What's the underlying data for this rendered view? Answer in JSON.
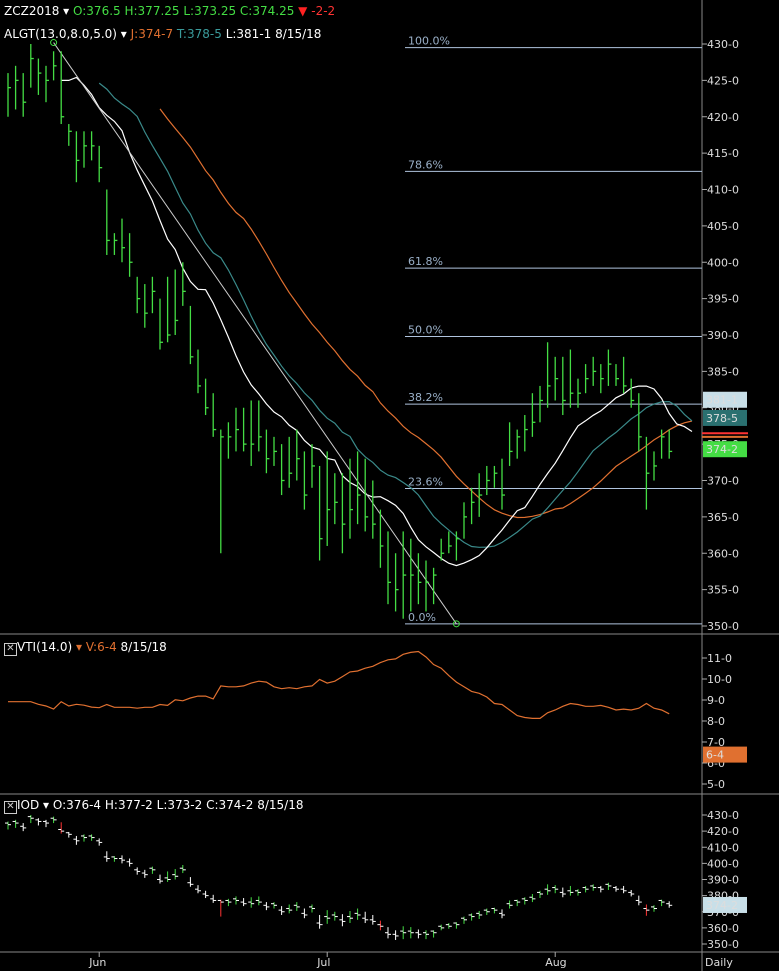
{
  "price_header": {
    "symbol": "ZCZ2018",
    "ohlc_open": "O:376.5",
    "ohlc_high": "H:377.25",
    "ohlc_low": "L:373.25",
    "ohlc_close": "C:374.25",
    "change": "-2-2"
  },
  "alligator_header": {
    "study": "ALGT(13.0,8.0,5.0)",
    "jaw": "J:374-7",
    "teeth": "T:378-5",
    "lips": "L:381-1",
    "date": "8/15/18"
  },
  "vti_header": {
    "study": "VTI(14.0)",
    "value": "V:6-4",
    "date": "8/15/18"
  },
  "iod_header": {
    "study": "IOD",
    "open": "O:376-4",
    "high": "H:377-2",
    "low": "L:373-2",
    "close": "C:374-2",
    "date": "8/15/18"
  },
  "badges": {
    "lips_badge": "381-1",
    "teeth_badge": "378-5",
    "price_badge": "374-2",
    "vti_badge": "6-4",
    "iod_badge": "374-2"
  },
  "colors": {
    "bar_green": "#44dd44",
    "bar_red": "#ff3333",
    "jaw": "#e07030",
    "teeth": "#3a8a8a",
    "lips": "#ffffff",
    "fib": "#b0c4de"
  },
  "x_axis": {
    "labels": [
      "Jun",
      "Jul",
      "Aug"
    ],
    "period": "Daily"
  },
  "chart_data": [
    {
      "type": "ohlc",
      "panel": "price",
      "ylim": [
        350,
        432
      ],
      "y_ticks": [
        "430-0",
        "425-0",
        "420-0",
        "415-0",
        "410-0",
        "405-0",
        "400-0",
        "395-0",
        "390-0",
        "385-0",
        "380-0",
        "375-0",
        "370-0",
        "365-0",
        "360-0",
        "355-0",
        "350-0"
      ],
      "fibonacci": [
        {
          "label": "100.0%",
          "value": 429.5
        },
        {
          "label": "78.6%",
          "value": 412.5
        },
        {
          "label": "61.8%",
          "value": 399.2
        },
        {
          "label": "50.0%",
          "value": 389.8
        },
        {
          "label": "38.2%",
          "value": 380.5
        },
        {
          "label": "23.6%",
          "value": 368.9
        },
        {
          "label": "0.0%",
          "value": 350.3
        }
      ],
      "bars": [
        {
          "h": 426,
          "l": 420,
          "c": 424
        },
        {
          "h": 427,
          "l": 421,
          "c": 425
        },
        {
          "h": 426,
          "l": 420,
          "c": 422
        },
        {
          "h": 430,
          "l": 424,
          "c": 428
        },
        {
          "h": 428,
          "l": 423,
          "c": 426
        },
        {
          "h": 427,
          "l": 422,
          "c": 425
        },
        {
          "h": 429,
          "l": 425,
          "c": 427
        },
        {
          "h": 429,
          "l": 419,
          "c": 420
        },
        {
          "h": 419,
          "l": 416,
          "c": 418
        },
        {
          "h": 418,
          "l": 411,
          "c": 414
        },
        {
          "h": 418,
          "l": 413,
          "c": 416
        },
        {
          "h": 418,
          "l": 414,
          "c": 416
        },
        {
          "h": 416,
          "l": 411,
          "c": 413
        },
        {
          "h": 410,
          "l": 401,
          "c": 403
        },
        {
          "h": 404,
          "l": 401,
          "c": 403
        },
        {
          "h": 406,
          "l": 400,
          "c": 402
        },
        {
          "h": 404,
          "l": 398,
          "c": 400
        },
        {
          "h": 398,
          "l": 393,
          "c": 395
        },
        {
          "h": 397,
          "l": 391,
          "c": 393
        },
        {
          "h": 398,
          "l": 393,
          "c": 396
        },
        {
          "h": 395,
          "l": 388,
          "c": 389
        },
        {
          "h": 398,
          "l": 389,
          "c": 390
        },
        {
          "h": 399,
          "l": 390,
          "c": 392
        },
        {
          "h": 400,
          "l": 394,
          "c": 396
        },
        {
          "h": 394,
          "l": 386,
          "c": 387
        },
        {
          "h": 388,
          "l": 382,
          "c": 383
        },
        {
          "h": 384,
          "l": 379,
          "c": 380
        },
        {
          "h": 382,
          "l": 376,
          "c": 377
        },
        {
          "h": 377,
          "l": 360,
          "c": 376
        },
        {
          "h": 378,
          "l": 373,
          "c": 376
        },
        {
          "h": 380,
          "l": 374,
          "c": 377
        },
        {
          "h": 380,
          "l": 374,
          "c": 375
        },
        {
          "h": 381,
          "l": 372,
          "c": 375
        },
        {
          "h": 381,
          "l": 374,
          "c": 376
        },
        {
          "h": 377,
          "l": 371,
          "c": 373
        },
        {
          "h": 376,
          "l": 372,
          "c": 374
        },
        {
          "h": 375,
          "l": 368,
          "c": 370
        },
        {
          "h": 376,
          "l": 369,
          "c": 371
        },
        {
          "h": 377,
          "l": 370,
          "c": 373
        },
        {
          "h": 374,
          "l": 366,
          "c": 368
        },
        {
          "h": 375,
          "l": 369,
          "c": 372
        },
        {
          "h": 372,
          "l": 359,
          "c": 362
        },
        {
          "h": 374,
          "l": 361,
          "c": 366
        },
        {
          "h": 371,
          "l": 364,
          "c": 367
        },
        {
          "h": 371,
          "l": 360,
          "c": 364
        },
        {
          "h": 373,
          "l": 362,
          "c": 366
        },
        {
          "h": 374,
          "l": 364,
          "c": 368
        },
        {
          "h": 373,
          "l": 363,
          "c": 365
        },
        {
          "h": 370,
          "l": 362,
          "c": 364
        },
        {
          "h": 366,
          "l": 358,
          "c": 361
        },
        {
          "h": 363,
          "l": 353,
          "c": 356
        },
        {
          "h": 360,
          "l": 352,
          "c": 355
        },
        {
          "h": 363,
          "l": 351,
          "c": 357
        },
        {
          "h": 362,
          "l": 352,
          "c": 357
        },
        {
          "h": 360,
          "l": 353,
          "c": 356
        },
        {
          "h": 359,
          "l": 352,
          "c": 356
        },
        {
          "h": 358,
          "l": 353,
          "c": 357
        },
        {
          "h": 362,
          "l": 359,
          "c": 360
        },
        {
          "h": 363,
          "l": 360,
          "c": 361
        },
        {
          "h": 363,
          "l": 359,
          "c": 362
        },
        {
          "h": 367,
          "l": 362,
          "c": 365
        },
        {
          "h": 369,
          "l": 364,
          "c": 367
        },
        {
          "h": 371,
          "l": 365,
          "c": 368
        },
        {
          "h": 372,
          "l": 368,
          "c": 370
        },
        {
          "h": 372,
          "l": 369,
          "c": 371
        },
        {
          "h": 373,
          "l": 366,
          "c": 368
        },
        {
          "h": 378,
          "l": 372,
          "c": 374
        },
        {
          "h": 377,
          "l": 373,
          "c": 376
        },
        {
          "h": 379,
          "l": 374,
          "c": 377
        },
        {
          "h": 382,
          "l": 376,
          "c": 378
        },
        {
          "h": 383,
          "l": 378,
          "c": 381
        },
        {
          "h": 389,
          "l": 380,
          "c": 383
        },
        {
          "h": 387,
          "l": 381,
          "c": 384
        },
        {
          "h": 387,
          "l": 379,
          "c": 381
        },
        {
          "h": 388,
          "l": 380,
          "c": 382
        },
        {
          "h": 384,
          "l": 380,
          "c": 382
        },
        {
          "h": 386,
          "l": 382,
          "c": 384
        },
        {
          "h": 387,
          "l": 383,
          "c": 385
        },
        {
          "h": 386,
          "l": 382,
          "c": 384
        },
        {
          "h": 388,
          "l": 383,
          "c": 386
        },
        {
          "h": 386,
          "l": 383,
          "c": 384
        },
        {
          "h": 387,
          "l": 382,
          "c": 383
        },
        {
          "h": 384,
          "l": 380,
          "c": 381
        },
        {
          "h": 382,
          "l": 374,
          "c": 376
        },
        {
          "h": 376,
          "l": 366,
          "c": 371
        },
        {
          "h": 374,
          "l": 370,
          "c": 372
        },
        {
          "h": 377,
          "l": 373,
          "c": 376
        },
        {
          "h": 377,
          "l": 373,
          "c": 374
        }
      ],
      "trendline": {
        "from_bar": 6,
        "from_value": 430.2,
        "to_bar": 59,
        "to_value": 350.3
      }
    },
    {
      "type": "line",
      "panel": "vti",
      "ylim": [
        5,
        11.5
      ],
      "y_ticks": [
        "11-0",
        "10-0",
        "9-0",
        "8-0",
        "7-0",
        "6-0",
        "5-0"
      ]
    },
    {
      "type": "ohlc",
      "panel": "iod",
      "ylim": [
        348,
        433
      ],
      "y_ticks": [
        "430-0",
        "420-0",
        "410-0",
        "400-0",
        "390-0",
        "380-0",
        "370-0",
        "360-0",
        "350-0"
      ]
    }
  ]
}
